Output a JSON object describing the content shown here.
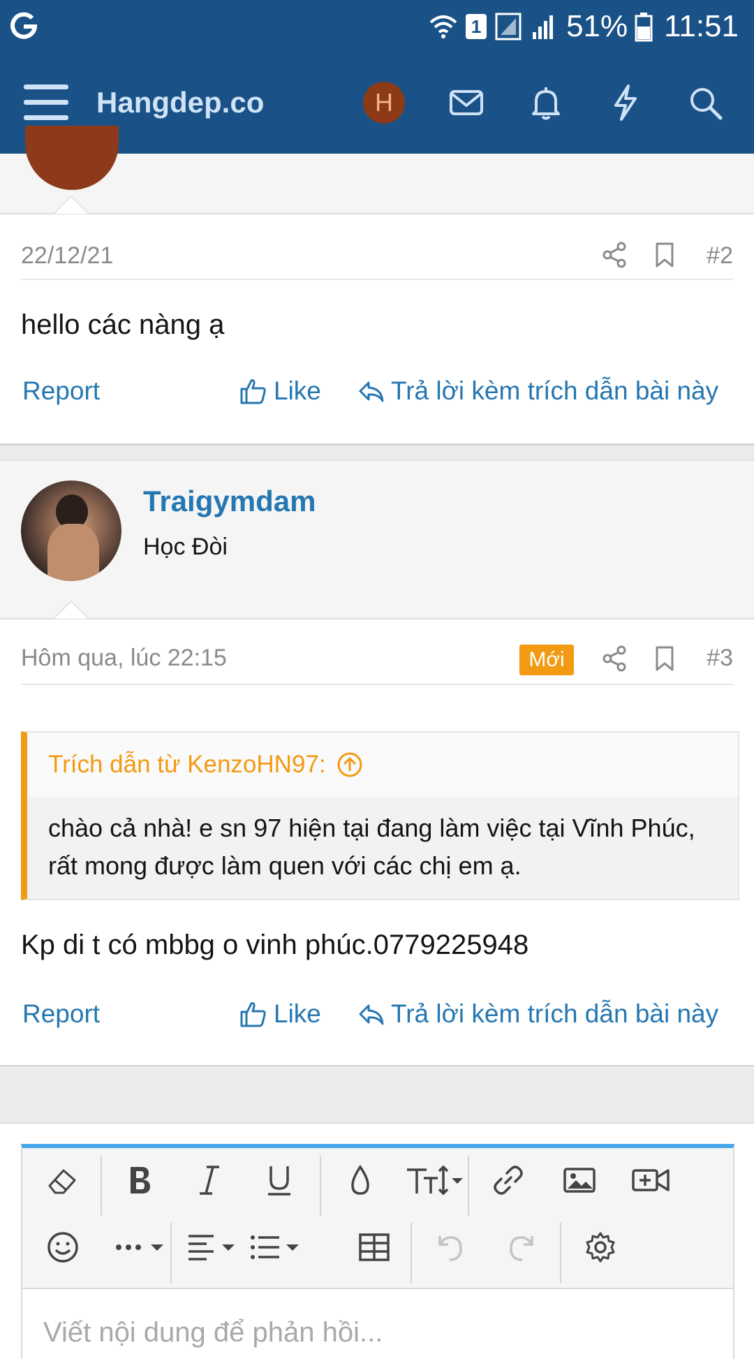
{
  "status_bar": {
    "battery": "51%",
    "time": "11:51",
    "notification_count": "1",
    "icons": [
      "google-g-icon",
      "wifi-icon",
      "sim-icon",
      "signal-icon",
      "battery-icon"
    ]
  },
  "header": {
    "brand": "Hangdep.co",
    "avatar_letter": "H",
    "icons": [
      "menu-icon",
      "mail-icon",
      "bell-icon",
      "bolt-icon",
      "search-icon"
    ],
    "colors": {
      "bar": "#1a5187",
      "avatar": "#8d3a17"
    }
  },
  "posts": [
    {
      "date": "22/12/21",
      "number": "#2",
      "body": "hello các nàng ạ",
      "actions": {
        "report": "Report",
        "like": "Like",
        "quote": "Trả lời kèm trích dẫn bài này"
      }
    },
    {
      "author": {
        "name": "Traigymdam",
        "title": "Học Đòi"
      },
      "date": "Hôm qua, lúc 22:15",
      "badge": "Mới",
      "number": "#3",
      "quote": {
        "header": "Trích dẫn từ KenzoHN97:",
        "text": "chào cả nhà! e sn 97 hiện tại đang làm việc tại Vĩnh Phúc, rất mong được làm quen với các chị em ạ."
      },
      "body": "Kp di t có mbbg o vinh phúc.0779225948",
      "actions": {
        "report": "Report",
        "like": "Like",
        "quote": "Trả lời kèm trích dẫn bài này"
      }
    }
  ],
  "editor": {
    "placeholder": "Viết nội dung để phản hồi...",
    "toolbar_icons": [
      "eraser-icon",
      "bold-icon",
      "italic-icon",
      "underline-icon",
      "color-drop-icon",
      "font-size-icon",
      "link-icon",
      "image-icon",
      "video-icon",
      "emoji-icon",
      "more-icon",
      "align-icon",
      "list-icon",
      "table-icon",
      "undo-icon",
      "redo-icon",
      "settings-icon"
    ],
    "accent": "#47a7eb"
  },
  "theme": {
    "link": "#2577b1",
    "badge": "#f29a12"
  }
}
